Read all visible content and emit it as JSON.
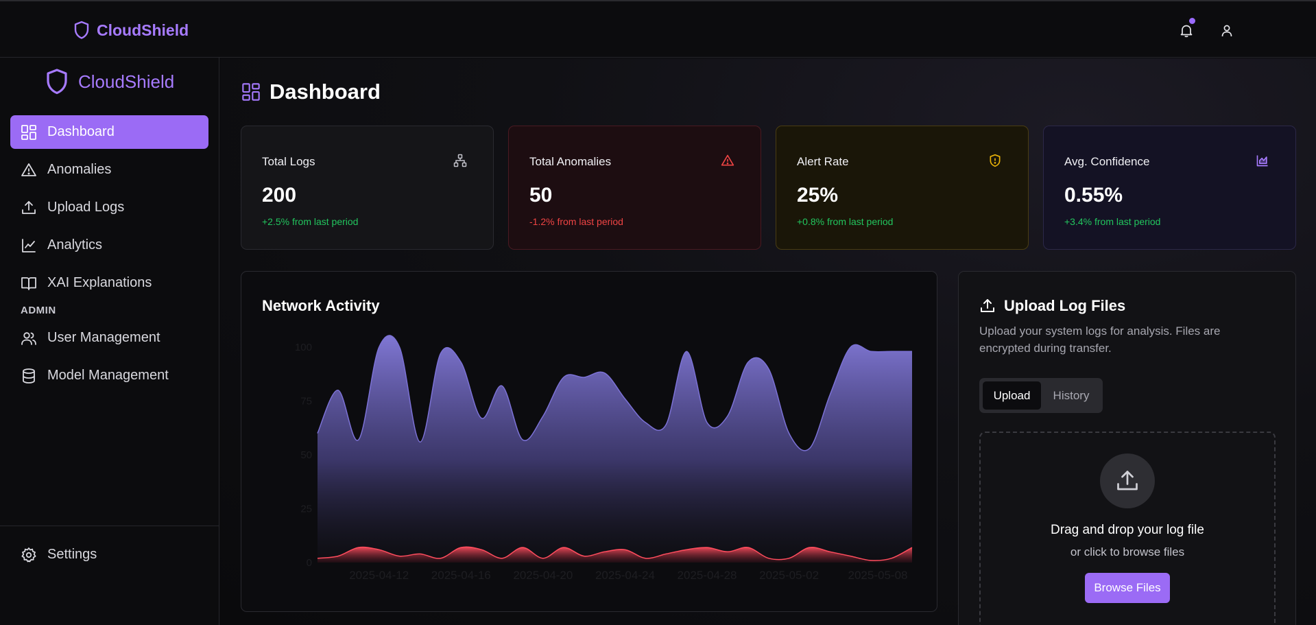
{
  "app": {
    "name": "CloudShield"
  },
  "topbar": {
    "icons": [
      "bell-icon",
      "user-icon"
    ],
    "has_notification": true
  },
  "sidebar": {
    "items": [
      {
        "label": "Dashboard",
        "icon": "layout-grid-icon",
        "active": true
      },
      {
        "label": "Anomalies",
        "icon": "alert-triangle-icon"
      },
      {
        "label": "Upload Logs",
        "icon": "upload-icon"
      },
      {
        "label": "Analytics",
        "icon": "line-chart-icon"
      },
      {
        "label": "XAI Explanations",
        "icon": "book-open-icon"
      }
    ],
    "section_label": "ADMIN",
    "admin_items": [
      {
        "label": "User Management",
        "icon": "users-icon"
      },
      {
        "label": "Model Management",
        "icon": "database-icon"
      }
    ],
    "footer_item": {
      "label": "Settings",
      "icon": "gear-icon"
    }
  },
  "page": {
    "title": "Dashboard"
  },
  "stats": [
    {
      "label": "Total Logs",
      "value": "200",
      "change": "+2.5% from last period",
      "icon": "network-icon",
      "change_color": "#22c55e"
    },
    {
      "label": "Total Anomalies",
      "value": "50",
      "change": "-1.2% from last period",
      "icon": "alert-triangle-icon",
      "change_color": "#ef4444"
    },
    {
      "label": "Alert Rate",
      "value": "25%",
      "change": "+0.8% from last period",
      "icon": "shield-alert-icon",
      "change_color": "#22c55e"
    },
    {
      "label": "Avg. Confidence",
      "value": "0.55%",
      "change": "+3.4% from last period",
      "icon": "area-chart-icon",
      "change_color": "#22c55e"
    }
  ],
  "chart": {
    "title": "Network Activity"
  },
  "chart_data": {
    "type": "area",
    "x": [
      "2025-04-09",
      "2025-04-10",
      "2025-04-11",
      "2025-04-12",
      "2025-04-13",
      "2025-04-14",
      "2025-04-15",
      "2025-04-16",
      "2025-04-17",
      "2025-04-18",
      "2025-04-19",
      "2025-04-20",
      "2025-04-21",
      "2025-04-22",
      "2025-04-23",
      "2025-04-24",
      "2025-04-25",
      "2025-04-26",
      "2025-04-27",
      "2025-04-28",
      "2025-04-29",
      "2025-04-30",
      "2025-05-01",
      "2025-05-02",
      "2025-05-03",
      "2025-05-04",
      "2025-05-05",
      "2025-05-06",
      "2025-05-07",
      "2025-05-08"
    ],
    "x_tick_labels": [
      "2025-04-12",
      "2025-04-16",
      "2025-04-20",
      "2025-04-24",
      "2025-04-28",
      "2025-05-02",
      "2025-05-08"
    ],
    "x_tick_dates": [
      "2025-04-12",
      "2025-04-16",
      "2025-04-20",
      "2025-04-24",
      "2025-04-28",
      "2025-05-02",
      "2025-05-08"
    ],
    "y_ticks": [
      0,
      25,
      50,
      75,
      100
    ],
    "ylim": [
      0,
      100
    ],
    "series": [
      {
        "color": "#7c72d6",
        "values": [
          60,
          80,
          57,
          100,
          100,
          56,
          97,
          93,
          67,
          82,
          57,
          68,
          86,
          86,
          88,
          76,
          65,
          64,
          98,
          65,
          68,
          93,
          90,
          60,
          53,
          78,
          100,
          98,
          98,
          98
        ]
      },
      {
        "color": "#ff4d5e",
        "values": [
          2,
          3,
          7,
          6,
          3,
          4,
          2,
          7,
          6,
          2,
          7,
          2,
          7,
          3,
          5,
          6,
          2,
          4,
          6,
          7,
          5,
          7,
          2,
          2,
          7,
          5,
          3,
          1,
          2,
          7
        ]
      }
    ],
    "grid": false,
    "legend": "none"
  },
  "upload": {
    "title": "Upload Log Files",
    "description": "Upload your system logs for analysis. Files are encrypted during transfer.",
    "tabs": [
      "Upload",
      "History"
    ],
    "active_tab": "Upload",
    "drop_main": "Drag and drop your log file",
    "drop_sub": "or click to browse files",
    "browse_label": "Browse Files"
  }
}
